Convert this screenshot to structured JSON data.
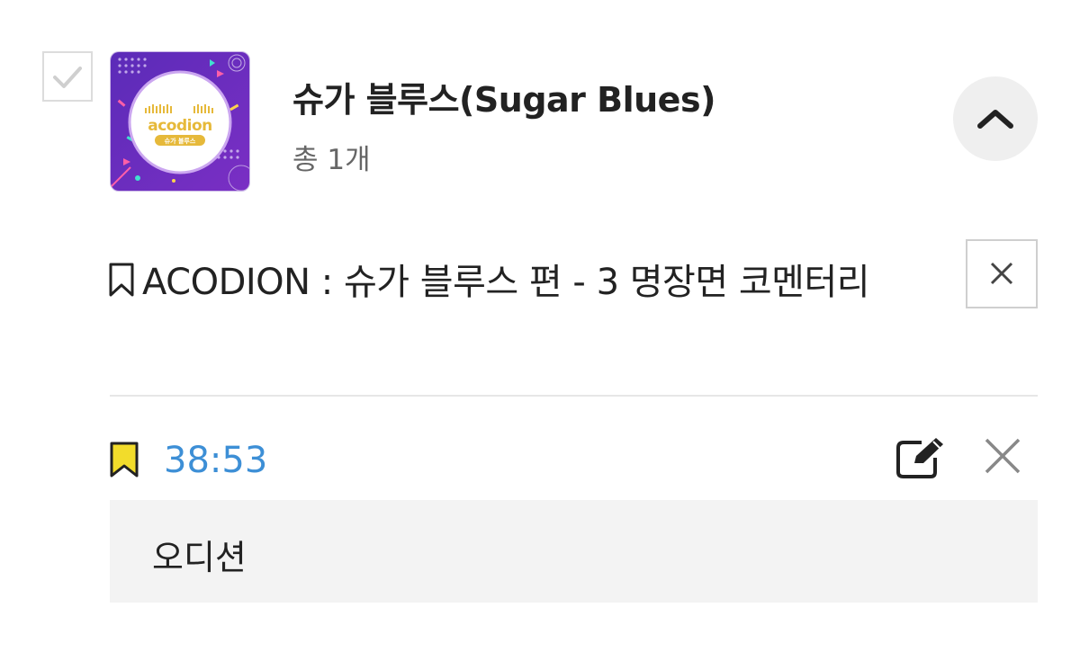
{
  "album": {
    "title": "슈가 블루스(Sugar Blues)",
    "count": "총 1개",
    "logo_text": "acodion",
    "logo_subtitle": "슈가 블루스"
  },
  "episode": {
    "title": "ACODION : 슈가 블루스 편 - 3 명장면 코멘터리"
  },
  "bookmark": {
    "time": "38:53",
    "memo": "오디션",
    "flag_color": "#f2dc2b",
    "time_color": "#3d8fd6"
  },
  "icons": {
    "checkbox": "check-icon",
    "collapse": "chevron-up-icon",
    "episode_bookmark": "bookmark-outline-icon",
    "close": "close-icon",
    "flag": "bookmark-flag-icon",
    "edit": "edit-icon",
    "delete": "close-icon"
  }
}
